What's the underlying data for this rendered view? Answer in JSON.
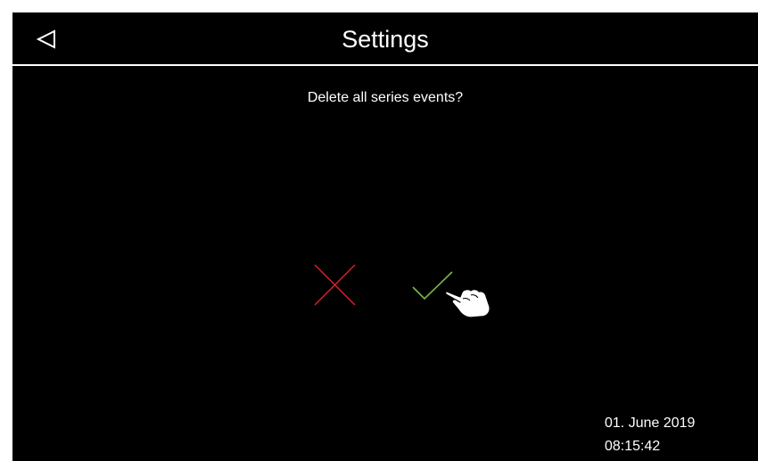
{
  "header": {
    "title": "Settings",
    "back_icon": "back-triangle-icon"
  },
  "dialog": {
    "question": "Delete all series events?",
    "cancel_icon": "cross-icon",
    "confirm_icon": "checkmark-icon",
    "pointer_icon": "hand-pointer-icon"
  },
  "status": {
    "date": "01. June 2019",
    "time": "08:15:42"
  },
  "colors": {
    "background": "#000000",
    "text": "#ffffff",
    "cancel": "#e0202a",
    "confirm": "#7ab648"
  }
}
